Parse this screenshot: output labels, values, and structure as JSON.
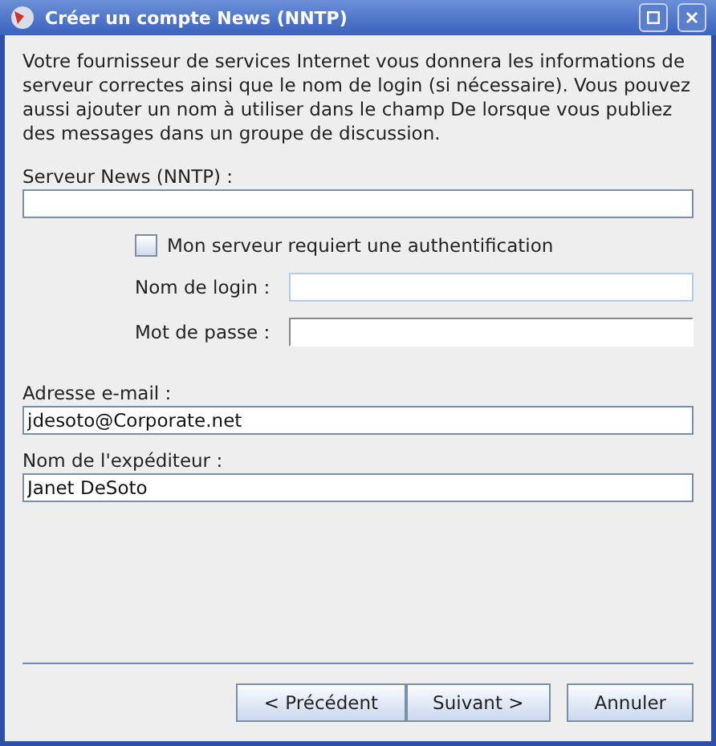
{
  "window": {
    "title": "Créer un compte News (NNTP)"
  },
  "intro": "Votre fournisseur de services Internet vous donnera les informations de serveur correctes ainsi que le nom de login (si nécessaire). Vous pouvez aussi ajouter un nom à utiliser dans le champ De lorsque vous publiez des messages dans un groupe de discussion.",
  "server": {
    "label": "Serveur News (NNTP) :"
  },
  "auth": {
    "label": "Mon serveur requiert une authentification",
    "checked": false
  },
  "login": {
    "label": "Nom de login :"
  },
  "password": {
    "label": "Mot de passe :"
  },
  "email": {
    "label": "Adresse e-mail :",
    "value": "jdesoto@Corporate.net"
  },
  "sender": {
    "label": "Nom de l'expéditeur :",
    "value": "Janet DeSoto"
  },
  "buttons": [
    {
      "label": "< Précédent"
    },
    {
      "label": "Suivant >"
    },
    {
      "label": "Annuler"
    }
  ]
}
